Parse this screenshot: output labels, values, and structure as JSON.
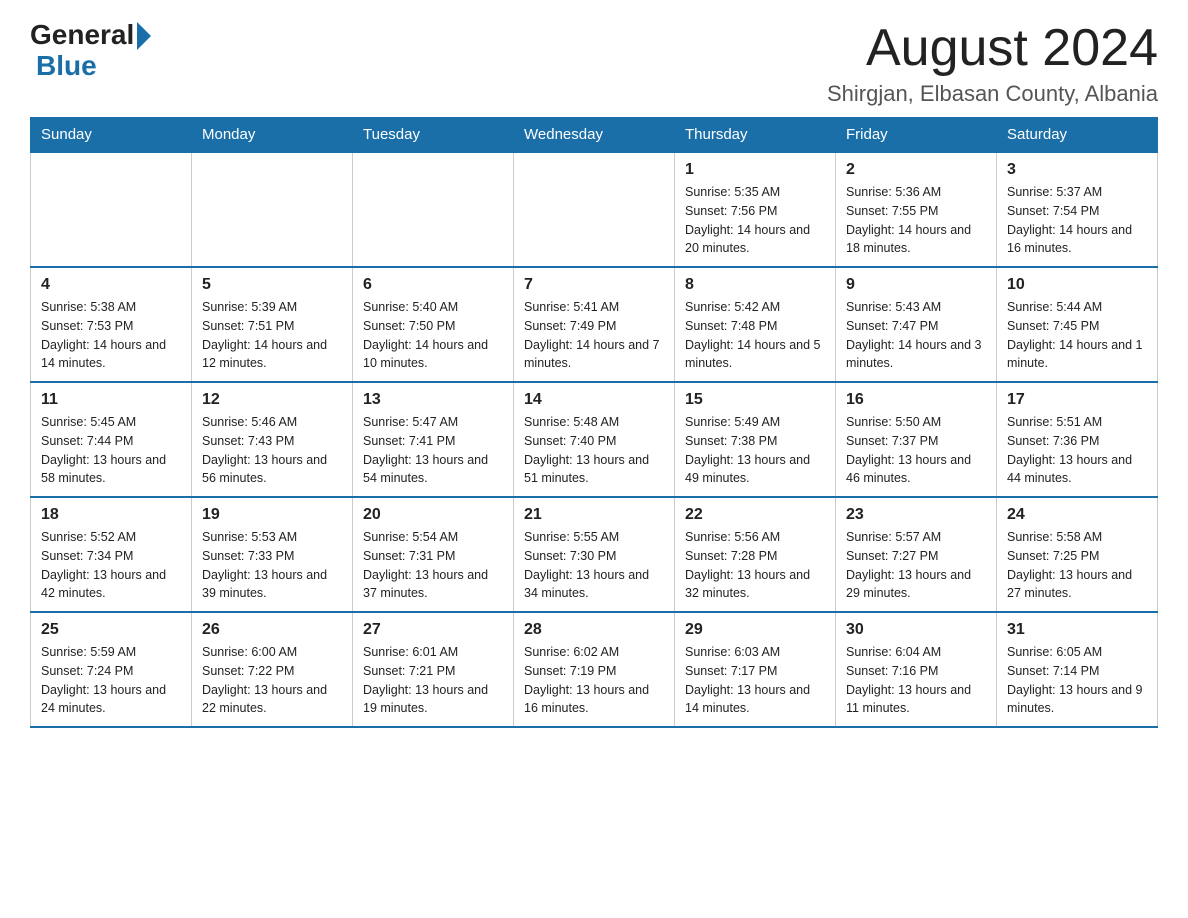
{
  "logo": {
    "general": "General",
    "blue": "Blue"
  },
  "title": "August 2024",
  "subtitle": "Shirgjan, Elbasan County, Albania",
  "headers": [
    "Sunday",
    "Monday",
    "Tuesday",
    "Wednesday",
    "Thursday",
    "Friday",
    "Saturday"
  ],
  "weeks": [
    [
      {
        "day": "",
        "info": ""
      },
      {
        "day": "",
        "info": ""
      },
      {
        "day": "",
        "info": ""
      },
      {
        "day": "",
        "info": ""
      },
      {
        "day": "1",
        "info": "Sunrise: 5:35 AM\nSunset: 7:56 PM\nDaylight: 14 hours and 20 minutes."
      },
      {
        "day": "2",
        "info": "Sunrise: 5:36 AM\nSunset: 7:55 PM\nDaylight: 14 hours and 18 minutes."
      },
      {
        "day": "3",
        "info": "Sunrise: 5:37 AM\nSunset: 7:54 PM\nDaylight: 14 hours and 16 minutes."
      }
    ],
    [
      {
        "day": "4",
        "info": "Sunrise: 5:38 AM\nSunset: 7:53 PM\nDaylight: 14 hours and 14 minutes."
      },
      {
        "day": "5",
        "info": "Sunrise: 5:39 AM\nSunset: 7:51 PM\nDaylight: 14 hours and 12 minutes."
      },
      {
        "day": "6",
        "info": "Sunrise: 5:40 AM\nSunset: 7:50 PM\nDaylight: 14 hours and 10 minutes."
      },
      {
        "day": "7",
        "info": "Sunrise: 5:41 AM\nSunset: 7:49 PM\nDaylight: 14 hours and 7 minutes."
      },
      {
        "day": "8",
        "info": "Sunrise: 5:42 AM\nSunset: 7:48 PM\nDaylight: 14 hours and 5 minutes."
      },
      {
        "day": "9",
        "info": "Sunrise: 5:43 AM\nSunset: 7:47 PM\nDaylight: 14 hours and 3 minutes."
      },
      {
        "day": "10",
        "info": "Sunrise: 5:44 AM\nSunset: 7:45 PM\nDaylight: 14 hours and 1 minute."
      }
    ],
    [
      {
        "day": "11",
        "info": "Sunrise: 5:45 AM\nSunset: 7:44 PM\nDaylight: 13 hours and 58 minutes."
      },
      {
        "day": "12",
        "info": "Sunrise: 5:46 AM\nSunset: 7:43 PM\nDaylight: 13 hours and 56 minutes."
      },
      {
        "day": "13",
        "info": "Sunrise: 5:47 AM\nSunset: 7:41 PM\nDaylight: 13 hours and 54 minutes."
      },
      {
        "day": "14",
        "info": "Sunrise: 5:48 AM\nSunset: 7:40 PM\nDaylight: 13 hours and 51 minutes."
      },
      {
        "day": "15",
        "info": "Sunrise: 5:49 AM\nSunset: 7:38 PM\nDaylight: 13 hours and 49 minutes."
      },
      {
        "day": "16",
        "info": "Sunrise: 5:50 AM\nSunset: 7:37 PM\nDaylight: 13 hours and 46 minutes."
      },
      {
        "day": "17",
        "info": "Sunrise: 5:51 AM\nSunset: 7:36 PM\nDaylight: 13 hours and 44 minutes."
      }
    ],
    [
      {
        "day": "18",
        "info": "Sunrise: 5:52 AM\nSunset: 7:34 PM\nDaylight: 13 hours and 42 minutes."
      },
      {
        "day": "19",
        "info": "Sunrise: 5:53 AM\nSunset: 7:33 PM\nDaylight: 13 hours and 39 minutes."
      },
      {
        "day": "20",
        "info": "Sunrise: 5:54 AM\nSunset: 7:31 PM\nDaylight: 13 hours and 37 minutes."
      },
      {
        "day": "21",
        "info": "Sunrise: 5:55 AM\nSunset: 7:30 PM\nDaylight: 13 hours and 34 minutes."
      },
      {
        "day": "22",
        "info": "Sunrise: 5:56 AM\nSunset: 7:28 PM\nDaylight: 13 hours and 32 minutes."
      },
      {
        "day": "23",
        "info": "Sunrise: 5:57 AM\nSunset: 7:27 PM\nDaylight: 13 hours and 29 minutes."
      },
      {
        "day": "24",
        "info": "Sunrise: 5:58 AM\nSunset: 7:25 PM\nDaylight: 13 hours and 27 minutes."
      }
    ],
    [
      {
        "day": "25",
        "info": "Sunrise: 5:59 AM\nSunset: 7:24 PM\nDaylight: 13 hours and 24 minutes."
      },
      {
        "day": "26",
        "info": "Sunrise: 6:00 AM\nSunset: 7:22 PM\nDaylight: 13 hours and 22 minutes."
      },
      {
        "day": "27",
        "info": "Sunrise: 6:01 AM\nSunset: 7:21 PM\nDaylight: 13 hours and 19 minutes."
      },
      {
        "day": "28",
        "info": "Sunrise: 6:02 AM\nSunset: 7:19 PM\nDaylight: 13 hours and 16 minutes."
      },
      {
        "day": "29",
        "info": "Sunrise: 6:03 AM\nSunset: 7:17 PM\nDaylight: 13 hours and 14 minutes."
      },
      {
        "day": "30",
        "info": "Sunrise: 6:04 AM\nSunset: 7:16 PM\nDaylight: 13 hours and 11 minutes."
      },
      {
        "day": "31",
        "info": "Sunrise: 6:05 AM\nSunset: 7:14 PM\nDaylight: 13 hours and 9 minutes."
      }
    ]
  ]
}
